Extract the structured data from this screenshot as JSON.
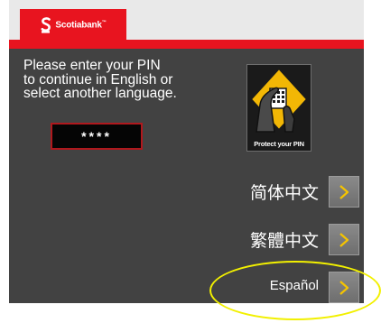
{
  "brand": {
    "name": "Scotiabank",
    "trademark": "™",
    "color": "#e8141f"
  },
  "prompt": {
    "text": "Please enter your PIN\nto continue in English or\nselect another language."
  },
  "pin": {
    "masked_value": "****"
  },
  "poster": {
    "caption": "Protect your PIN",
    "icon": "hand-shielding-keypad-icon"
  },
  "languages": [
    {
      "label": "简体中文",
      "button_icon": "chevron-right-icon"
    },
    {
      "label": "繁體中文",
      "button_icon": "chevron-right-icon"
    },
    {
      "label": "Español",
      "button_icon": "chevron-right-icon",
      "highlighted": true
    }
  ],
  "colors": {
    "panel": "#424242",
    "accent": "#e8141f",
    "highlight": "#f2f000",
    "chevron": "#f5c400"
  }
}
